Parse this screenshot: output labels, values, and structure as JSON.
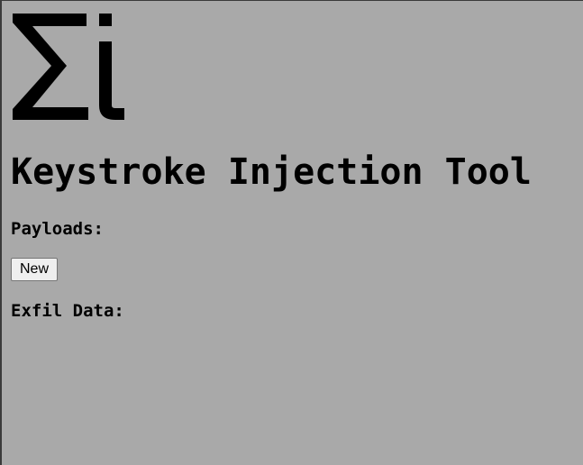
{
  "logo": {
    "text": "Σi",
    "icon": "sigma-i-logo"
  },
  "header": {
    "title": "Keystroke Injection Tool"
  },
  "payloads": {
    "heading": "Payloads:",
    "new_button_label": "New"
  },
  "exfil": {
    "heading": "Exfil Data:"
  },
  "colors": {
    "background": "#a9a9a9",
    "text": "#000000",
    "button_background": "#efefef",
    "button_border": "#767676"
  }
}
